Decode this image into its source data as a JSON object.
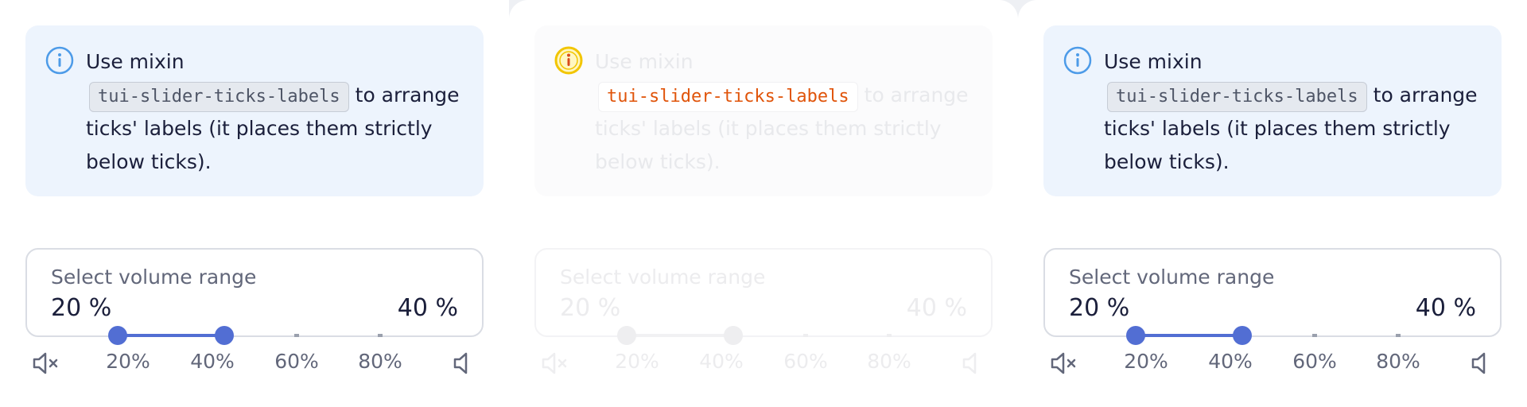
{
  "notice": {
    "text_before": "Use mixin",
    "code": "tui-slider-ticks-labels",
    "text_after": "to arrange ticks' labels (it places them strictly below ticks)."
  },
  "field": {
    "label": "Select volume range",
    "min_value": "20 %",
    "max_value": "40 %"
  },
  "slider": {
    "range_start_percent": 20,
    "range_end_percent": 40,
    "tick_labels": [
      "20%",
      "40%",
      "60%",
      "80%"
    ],
    "left_icon": "volume-mute-icon",
    "right_icon": "volume-icon"
  },
  "colors": {
    "accent": "#526ed3",
    "notice_bg": "#edf4fd",
    "info_icon": "#4d9be8",
    "faded_code": "#e0540a",
    "faded_info_ring": "#f2c500"
  }
}
